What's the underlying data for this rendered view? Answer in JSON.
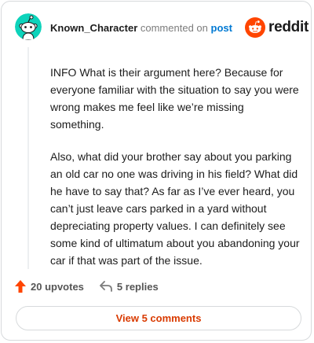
{
  "header": {
    "username": "Known_Character",
    "action": "commented on",
    "target": "post"
  },
  "brand": {
    "logo_text": "reddit",
    "color": "#ff4500"
  },
  "avatar": {
    "bg_color": "#0dd3bb"
  },
  "comment": {
    "paragraphs": [
      "INFO What is their argument here? Because for everyone familiar with the situation to say you were wrong makes me feel like we’re missing something.",
      "Also, what did your brother say about you parking an old car no one was driving in his field? What did he have to say that? As far as I’ve ever heard, you can’t just leave cars parked in a yard without depreciating property values. I can definitely see some kind of ultimatum about you abandoning your car if that was part of the issue."
    ]
  },
  "actions": {
    "upvotes": "20 upvotes",
    "replies": "5 replies",
    "upvote_icon": "upvote-arrow-icon",
    "reply_icon": "reply-arrow-icon"
  },
  "footer": {
    "view_comments": "View 5 comments",
    "accent": "#d93a00"
  }
}
